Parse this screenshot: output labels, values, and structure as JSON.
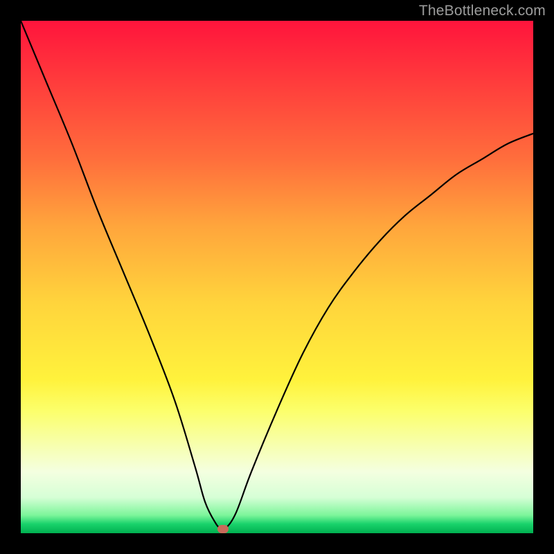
{
  "watermark": "TheBottleneck.com",
  "chart_data": {
    "type": "line",
    "title": "",
    "xlabel": "",
    "ylabel": "",
    "xlim": [
      0,
      100
    ],
    "ylim": [
      0,
      100
    ],
    "grid": false,
    "legend": false,
    "series": [
      {
        "name": "bottleneck-curve",
        "x": [
          0,
          5,
          10,
          15,
          20,
          25,
          30,
          34,
          36,
          38,
          39,
          40,
          42,
          45,
          50,
          55,
          60,
          65,
          70,
          75,
          80,
          85,
          90,
          95,
          100
        ],
        "y": [
          100,
          88,
          76,
          63,
          51,
          39,
          26,
          13,
          6,
          2,
          1,
          1,
          4,
          12,
          24,
          35,
          44,
          51,
          57,
          62,
          66,
          70,
          73,
          76,
          78
        ]
      }
    ],
    "annotations": [
      {
        "name": "optimal-marker",
        "x": 39.5,
        "y": 0.8
      }
    ],
    "background_gradient": {
      "direction": "vertical",
      "stops": [
        {
          "pos": 0.0,
          "color": "#ff143c"
        },
        {
          "pos": 0.12,
          "color": "#ff3c3c"
        },
        {
          "pos": 0.27,
          "color": "#ff6e3c"
        },
        {
          "pos": 0.4,
          "color": "#ffa53c"
        },
        {
          "pos": 0.55,
          "color": "#ffd43c"
        },
        {
          "pos": 0.7,
          "color": "#fff23c"
        },
        {
          "pos": 0.83,
          "color": "#f7ffb0"
        },
        {
          "pos": 0.93,
          "color": "#d6ffd6"
        },
        {
          "pos": 1.0,
          "color": "#00b050"
        }
      ]
    }
  }
}
